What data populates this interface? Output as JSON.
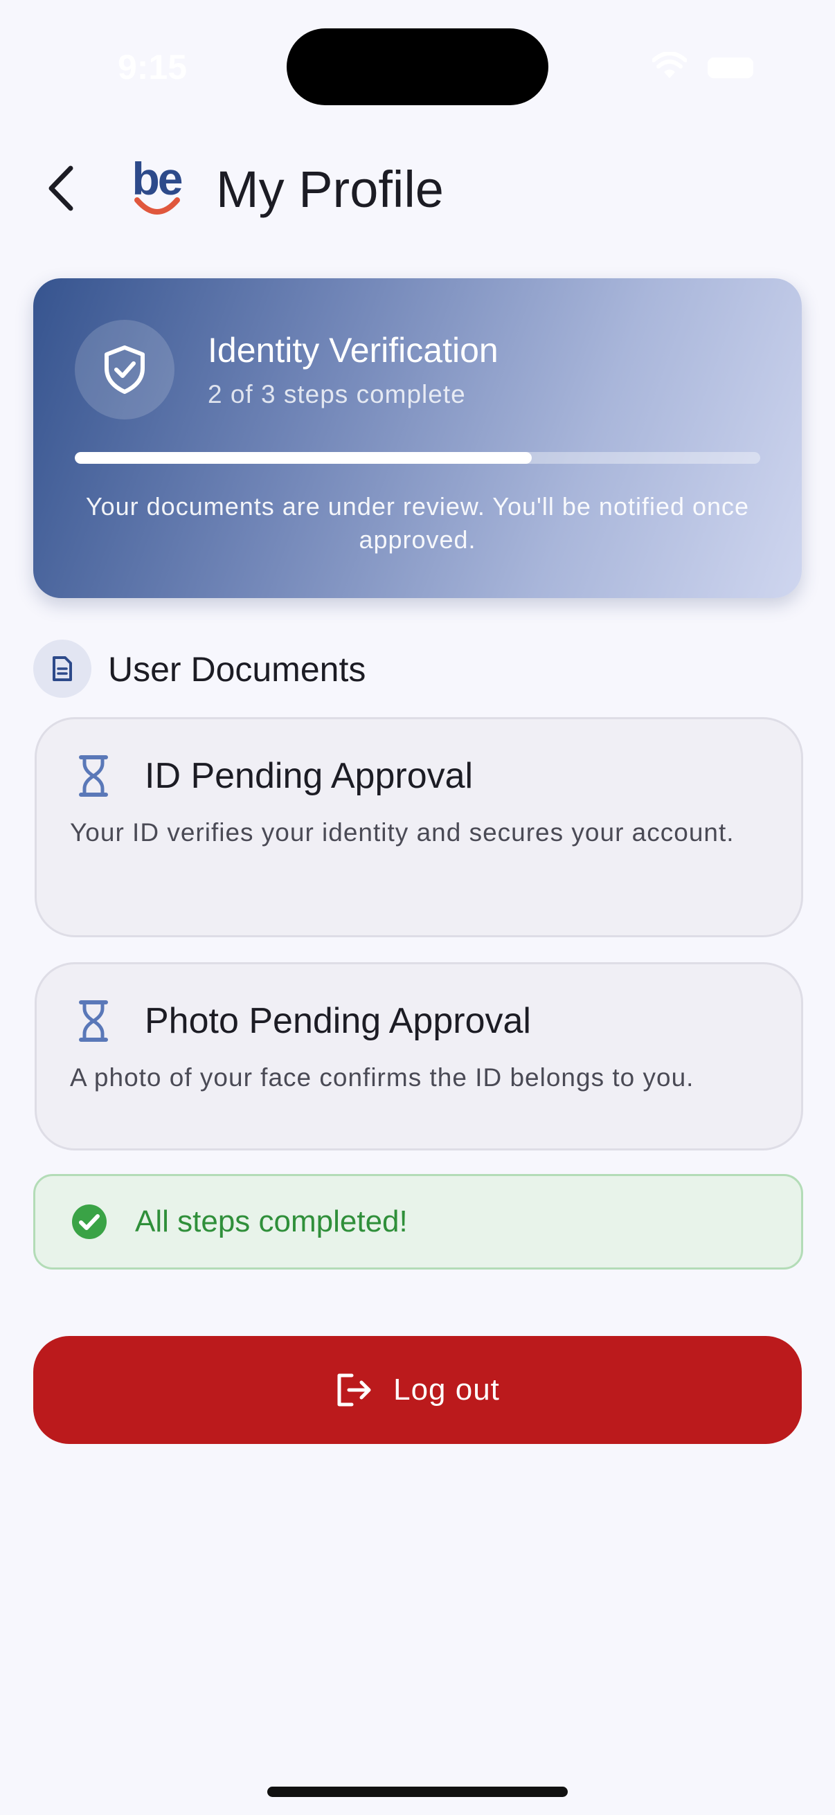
{
  "status_bar": {
    "time": "9:15"
  },
  "header": {
    "logo_text": "be",
    "title": "My Profile"
  },
  "verification": {
    "title": "Identity Verification",
    "steps_text": "2 of 3 steps complete",
    "progress": 0.667,
    "note": "Your documents are under review. You'll be notified once approved."
  },
  "documents": {
    "section_title": "User Documents",
    "items": [
      {
        "title": "ID Pending Approval",
        "description": "Your ID verifies your identity and secures your account."
      },
      {
        "title": "Photo Pending Approval",
        "description": "A photo of your face confirms the ID belongs to you."
      }
    ]
  },
  "completion": {
    "text": "All steps completed!"
  },
  "logout": {
    "label": "Log out"
  },
  "colors": {
    "accent": "#36548f",
    "logout": "#bb1a1c",
    "success": "#2f8f3a",
    "logo_smile": "#e0573d"
  }
}
